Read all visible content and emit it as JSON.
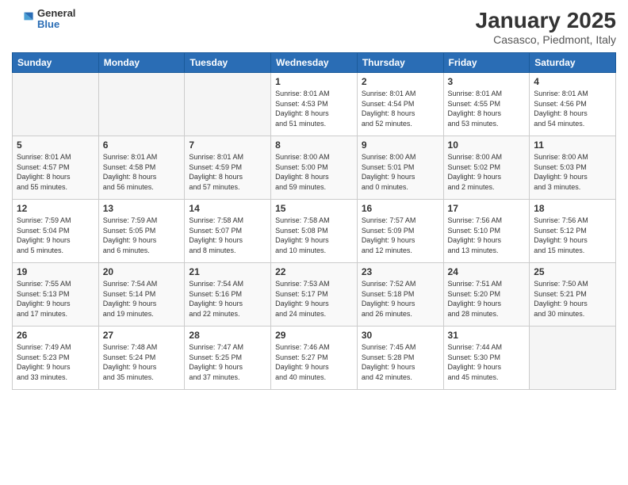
{
  "header": {
    "logo_general": "General",
    "logo_blue": "Blue",
    "month_title": "January 2025",
    "subtitle": "Casasco, Piedmont, Italy"
  },
  "weekdays": [
    "Sunday",
    "Monday",
    "Tuesday",
    "Wednesday",
    "Thursday",
    "Friday",
    "Saturday"
  ],
  "weeks": [
    [
      {
        "day": "",
        "info": ""
      },
      {
        "day": "",
        "info": ""
      },
      {
        "day": "",
        "info": ""
      },
      {
        "day": "1",
        "info": "Sunrise: 8:01 AM\nSunset: 4:53 PM\nDaylight: 8 hours\nand 51 minutes."
      },
      {
        "day": "2",
        "info": "Sunrise: 8:01 AM\nSunset: 4:54 PM\nDaylight: 8 hours\nand 52 minutes."
      },
      {
        "day": "3",
        "info": "Sunrise: 8:01 AM\nSunset: 4:55 PM\nDaylight: 8 hours\nand 53 minutes."
      },
      {
        "day": "4",
        "info": "Sunrise: 8:01 AM\nSunset: 4:56 PM\nDaylight: 8 hours\nand 54 minutes."
      }
    ],
    [
      {
        "day": "5",
        "info": "Sunrise: 8:01 AM\nSunset: 4:57 PM\nDaylight: 8 hours\nand 55 minutes."
      },
      {
        "day": "6",
        "info": "Sunrise: 8:01 AM\nSunset: 4:58 PM\nDaylight: 8 hours\nand 56 minutes."
      },
      {
        "day": "7",
        "info": "Sunrise: 8:01 AM\nSunset: 4:59 PM\nDaylight: 8 hours\nand 57 minutes."
      },
      {
        "day": "8",
        "info": "Sunrise: 8:00 AM\nSunset: 5:00 PM\nDaylight: 8 hours\nand 59 minutes."
      },
      {
        "day": "9",
        "info": "Sunrise: 8:00 AM\nSunset: 5:01 PM\nDaylight: 9 hours\nand 0 minutes."
      },
      {
        "day": "10",
        "info": "Sunrise: 8:00 AM\nSunset: 5:02 PM\nDaylight: 9 hours\nand 2 minutes."
      },
      {
        "day": "11",
        "info": "Sunrise: 8:00 AM\nSunset: 5:03 PM\nDaylight: 9 hours\nand 3 minutes."
      }
    ],
    [
      {
        "day": "12",
        "info": "Sunrise: 7:59 AM\nSunset: 5:04 PM\nDaylight: 9 hours\nand 5 minutes."
      },
      {
        "day": "13",
        "info": "Sunrise: 7:59 AM\nSunset: 5:05 PM\nDaylight: 9 hours\nand 6 minutes."
      },
      {
        "day": "14",
        "info": "Sunrise: 7:58 AM\nSunset: 5:07 PM\nDaylight: 9 hours\nand 8 minutes."
      },
      {
        "day": "15",
        "info": "Sunrise: 7:58 AM\nSunset: 5:08 PM\nDaylight: 9 hours\nand 10 minutes."
      },
      {
        "day": "16",
        "info": "Sunrise: 7:57 AM\nSunset: 5:09 PM\nDaylight: 9 hours\nand 12 minutes."
      },
      {
        "day": "17",
        "info": "Sunrise: 7:56 AM\nSunset: 5:10 PM\nDaylight: 9 hours\nand 13 minutes."
      },
      {
        "day": "18",
        "info": "Sunrise: 7:56 AM\nSunset: 5:12 PM\nDaylight: 9 hours\nand 15 minutes."
      }
    ],
    [
      {
        "day": "19",
        "info": "Sunrise: 7:55 AM\nSunset: 5:13 PM\nDaylight: 9 hours\nand 17 minutes."
      },
      {
        "day": "20",
        "info": "Sunrise: 7:54 AM\nSunset: 5:14 PM\nDaylight: 9 hours\nand 19 minutes."
      },
      {
        "day": "21",
        "info": "Sunrise: 7:54 AM\nSunset: 5:16 PM\nDaylight: 9 hours\nand 22 minutes."
      },
      {
        "day": "22",
        "info": "Sunrise: 7:53 AM\nSunset: 5:17 PM\nDaylight: 9 hours\nand 24 minutes."
      },
      {
        "day": "23",
        "info": "Sunrise: 7:52 AM\nSunset: 5:18 PM\nDaylight: 9 hours\nand 26 minutes."
      },
      {
        "day": "24",
        "info": "Sunrise: 7:51 AM\nSunset: 5:20 PM\nDaylight: 9 hours\nand 28 minutes."
      },
      {
        "day": "25",
        "info": "Sunrise: 7:50 AM\nSunset: 5:21 PM\nDaylight: 9 hours\nand 30 minutes."
      }
    ],
    [
      {
        "day": "26",
        "info": "Sunrise: 7:49 AM\nSunset: 5:23 PM\nDaylight: 9 hours\nand 33 minutes."
      },
      {
        "day": "27",
        "info": "Sunrise: 7:48 AM\nSunset: 5:24 PM\nDaylight: 9 hours\nand 35 minutes."
      },
      {
        "day": "28",
        "info": "Sunrise: 7:47 AM\nSunset: 5:25 PM\nDaylight: 9 hours\nand 37 minutes."
      },
      {
        "day": "29",
        "info": "Sunrise: 7:46 AM\nSunset: 5:27 PM\nDaylight: 9 hours\nand 40 minutes."
      },
      {
        "day": "30",
        "info": "Sunrise: 7:45 AM\nSunset: 5:28 PM\nDaylight: 9 hours\nand 42 minutes."
      },
      {
        "day": "31",
        "info": "Sunrise: 7:44 AM\nSunset: 5:30 PM\nDaylight: 9 hours\nand 45 minutes."
      },
      {
        "day": "",
        "info": ""
      }
    ]
  ]
}
